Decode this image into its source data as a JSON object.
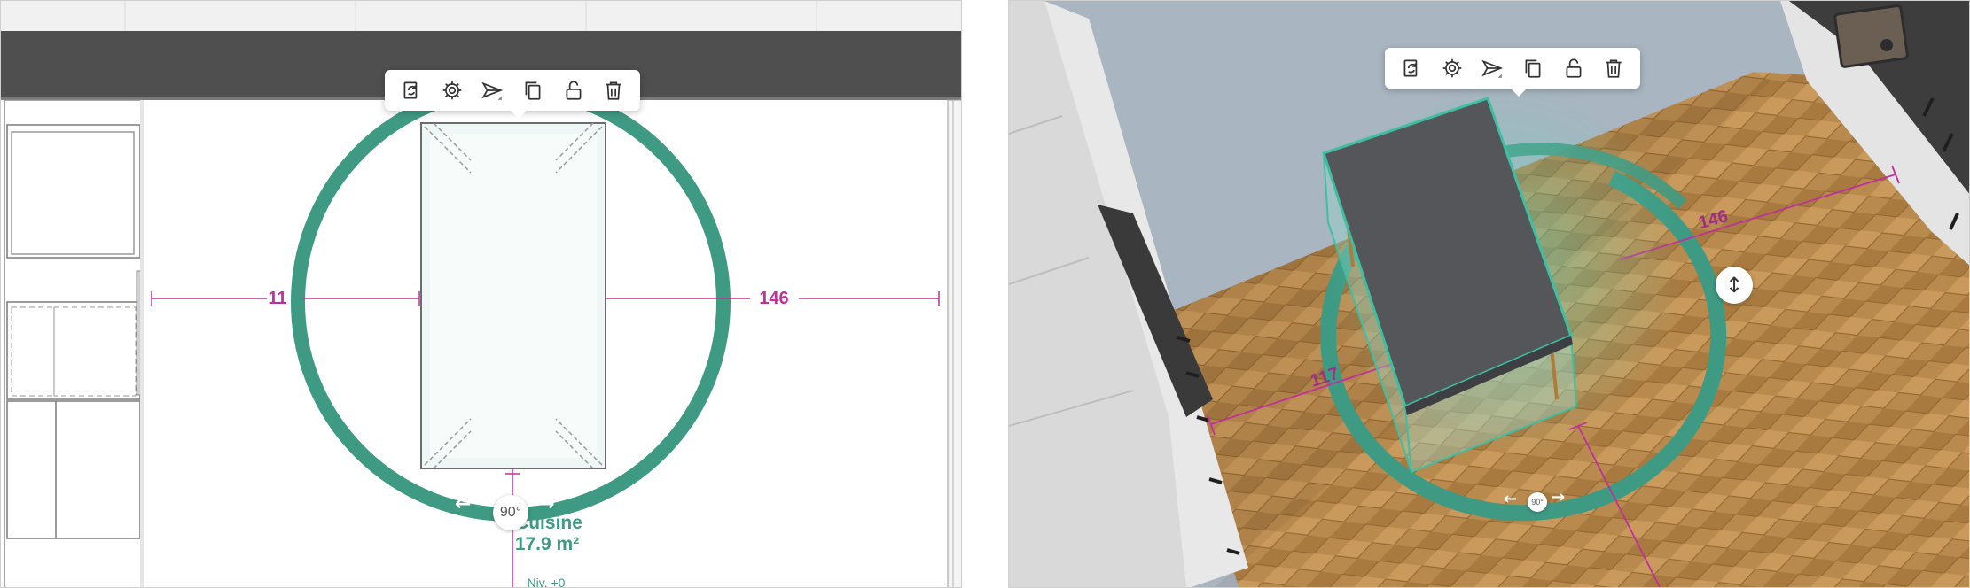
{
  "toolbar": {
    "buttons": [
      {
        "id": "replace",
        "icon": "replace-object-icon"
      },
      {
        "id": "settings",
        "icon": "gear-icon"
      },
      {
        "id": "align",
        "icon": "align-arrow-icon"
      },
      {
        "id": "duplicate",
        "icon": "duplicate-icon"
      },
      {
        "id": "lock",
        "icon": "unlock-icon"
      },
      {
        "id": "delete",
        "icon": "trash-icon"
      }
    ]
  },
  "plan_view": {
    "dimension_left": "11",
    "dimension_right": "146",
    "rotation_angle": "90°",
    "room_name": "Cuisine",
    "room_area": "17.9 m²",
    "level_label": "Niv. +0"
  },
  "view_3d": {
    "dimension_left": "117",
    "dimension_right": "146",
    "rotation_angle": "90°"
  },
  "colors": {
    "accent": "#3f9a83",
    "dimension": "#c0309a",
    "wall": "#4f4f4f",
    "countertop": "#555659",
    "floor": "#b8874a"
  }
}
